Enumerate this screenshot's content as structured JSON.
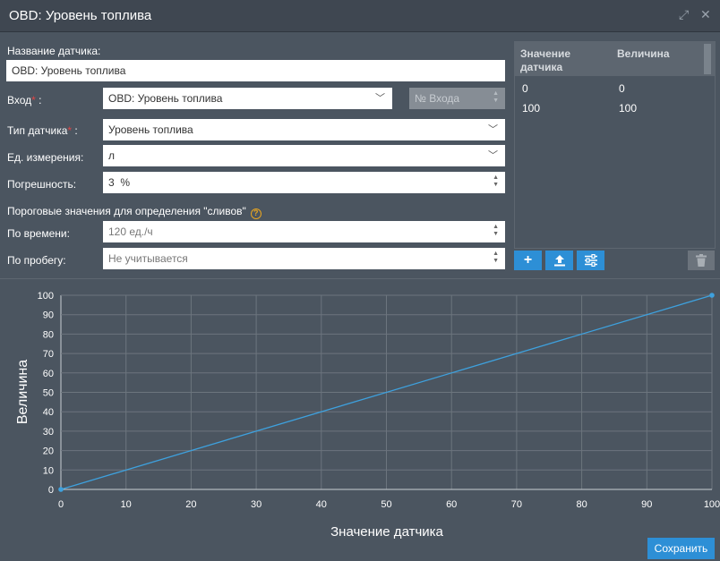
{
  "window": {
    "title": "OBD: Уровень топлива",
    "expand_icon": "expand-icon",
    "close_icon": "close-icon"
  },
  "form": {
    "name_label": "Название датчика:",
    "name_value": "OBD: Уровень топлива",
    "input_label": "Вход",
    "input_value": "OBD: Уровень топлива",
    "input_number_placeholder": "№ Входа",
    "type_label": "Тип датчика",
    "type_value": "Уровень топлива",
    "unit_label": "Ед. измерения:",
    "unit_value": "л",
    "error_label": "Погрешность:",
    "error_value": "3",
    "error_unit": "%",
    "thresholds_label": "Пороговые значения для определения \"сливов\"",
    "time_label": "По времени:",
    "time_value": "120 ед./ч",
    "mileage_label": "По пробегу:",
    "mileage_value": "Не учитывается",
    "required_mark": "*",
    "colon": ":",
    "help_mark": "?"
  },
  "table": {
    "headers": [
      "Значение\nдатчика",
      "Величина"
    ],
    "rows": [
      [
        "0",
        "0"
      ],
      [
        "100",
        "100"
      ]
    ]
  },
  "table_buttons": {
    "add": "+",
    "upload": "upload-icon",
    "settings": "sliders-icon",
    "delete": "trash-icon"
  },
  "chart_data": {
    "type": "line",
    "xlabel": "Значение датчика",
    "ylabel": "Величина",
    "xlim": [
      0,
      100
    ],
    "ylim": [
      0,
      100
    ],
    "x_ticks": [
      0,
      10,
      20,
      30,
      40,
      50,
      60,
      70,
      80,
      90,
      100
    ],
    "y_ticks": [
      0,
      10,
      20,
      30,
      40,
      50,
      60,
      70,
      80,
      90,
      100
    ],
    "grid": true,
    "line_color": "#3ea1de",
    "series": [
      {
        "x": [
          0,
          100
        ],
        "y": [
          0,
          100
        ]
      }
    ]
  },
  "save_label": "Сохранить",
  "colors": {
    "accent": "#2d8fd6",
    "background": "#4b5560",
    "titlebar": "#3f4751"
  }
}
